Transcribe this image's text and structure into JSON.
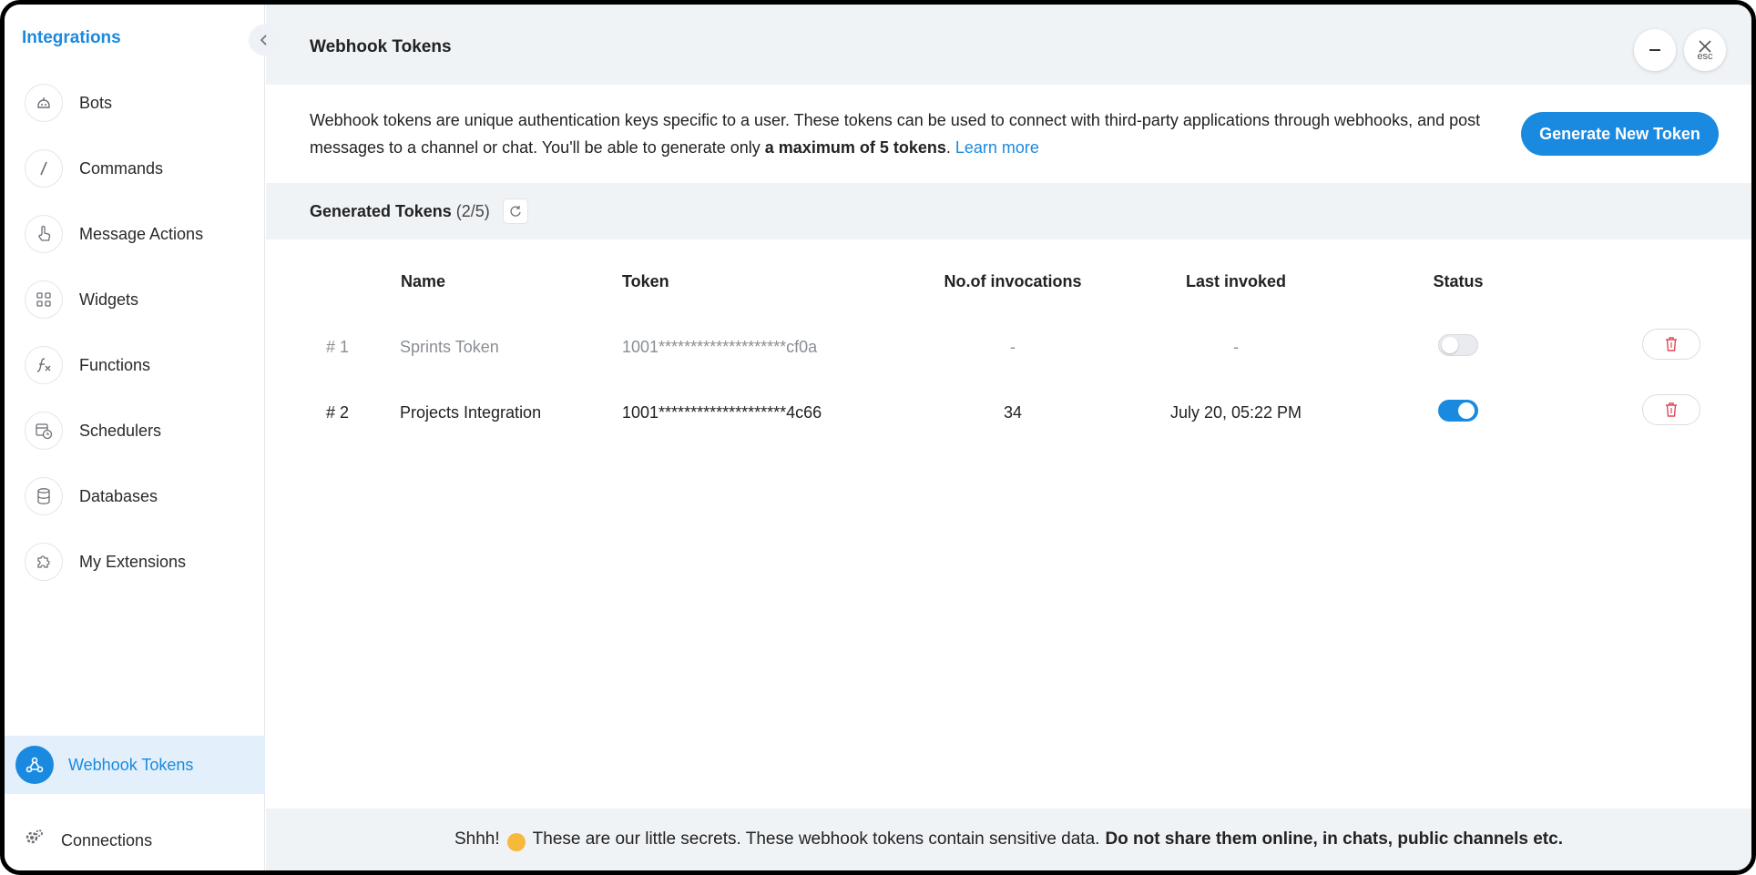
{
  "sidebar": {
    "title": "Integrations",
    "items": [
      {
        "label": "Bots",
        "icon": "bot-icon"
      },
      {
        "label": "Commands",
        "icon": "slash-icon"
      },
      {
        "label": "Message Actions",
        "icon": "hand-pointer-icon"
      },
      {
        "label": "Widgets",
        "icon": "grid-icon"
      },
      {
        "label": "Functions",
        "icon": "function-icon"
      },
      {
        "label": "Schedulers",
        "icon": "calendar-clock-icon"
      },
      {
        "label": "Databases",
        "icon": "database-icon"
      },
      {
        "label": "My Extensions",
        "icon": "puzzle-icon"
      }
    ],
    "active_item": {
      "label": "Webhook Tokens",
      "icon": "webhook-icon"
    },
    "bottom_item": {
      "label": "Connections",
      "icon": "gear-icon"
    }
  },
  "header": {
    "title": "Webhook Tokens",
    "esc_label": "esc"
  },
  "description": {
    "text_part1": "Webhook tokens are unique authentication keys specific to a user. These tokens can be used to connect with third-party applications through webhooks, and post messages to a channel or chat. You'll be able to generate only ",
    "bold_part": "a maximum of 5 tokens",
    "text_part2": ". ",
    "link": "Learn more"
  },
  "generate_button": "Generate New Token",
  "section": {
    "title": "Generated Tokens",
    "count": "(2/5)"
  },
  "table": {
    "headers": {
      "name": "Name",
      "token": "Token",
      "invocations": "No.of invocations",
      "last_invoked": "Last invoked",
      "status": "Status"
    },
    "rows": [
      {
        "index": "# 1",
        "name": "Sprints Token",
        "token": "1001********************cf0a",
        "invocations": "-",
        "last_invoked": "-",
        "enabled": false
      },
      {
        "index": "# 2",
        "name": "Projects Integration",
        "token": "1001********************4c66",
        "invocations": "34",
        "last_invoked": "July 20, 05:22 PM",
        "enabled": true
      }
    ]
  },
  "footer": {
    "text_part1": "Shhh!",
    "text_part2": "These are our little secrets. These webhook tokens contain sensitive data.",
    "bold_part": "Do not share them online, in chats, public channels etc."
  },
  "colors": {
    "accent": "#1a8ae0",
    "delete": "#e0485a"
  }
}
